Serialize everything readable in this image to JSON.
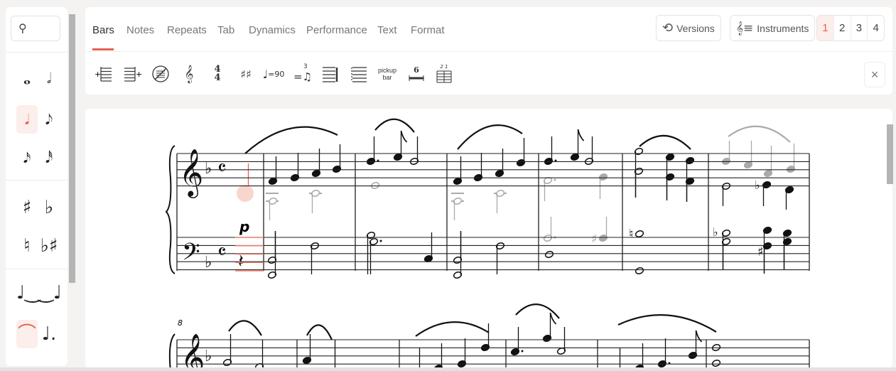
{
  "palette": {
    "search_placeholder": "",
    "search_icon": "magnifier-icon",
    "items": [
      {
        "name": "whole-note-icon",
        "glyph": "𝅝"
      },
      {
        "name": "half-note-icon",
        "glyph": "𝅗𝅥"
      },
      {
        "name": "quarter-note-icon",
        "glyph": "𝅘𝅥",
        "selected": true
      },
      {
        "name": "eighth-note-icon",
        "glyph": "𝅘𝅥𝅮"
      },
      {
        "name": "sixteenth-note-icon",
        "glyph": "𝅘𝅥𝅯"
      },
      {
        "name": "thirty-second-note-icon",
        "glyph": "𝅘𝅥𝅰"
      },
      {
        "name": "sharp-icon",
        "glyph": "♯"
      },
      {
        "name": "flat-icon",
        "glyph": "♭"
      },
      {
        "name": "natural-icon",
        "glyph": "♮"
      },
      {
        "name": "flat-sharp-icon",
        "glyph": "♭♯"
      },
      {
        "name": "tie-after-icon",
        "glyph": "♩‿"
      },
      {
        "name": "tie-before-icon",
        "glyph": "‿♩"
      },
      {
        "name": "slur-icon",
        "glyph": "⌒",
        "selected": true
      },
      {
        "name": "dotted-note-icon",
        "glyph": "♩."
      }
    ]
  },
  "tabs": [
    {
      "label": "Bars",
      "active": true
    },
    {
      "label": "Notes"
    },
    {
      "label": "Repeats"
    },
    {
      "label": "Tab"
    },
    {
      "label": "Dynamics"
    },
    {
      "label": "Performance"
    },
    {
      "label": "Text"
    },
    {
      "label": "Format"
    }
  ],
  "header": {
    "versions_label": "Versions",
    "instruments_label": "Instruments",
    "pages": [
      "1",
      "2",
      "3",
      "4"
    ],
    "active_page": "1"
  },
  "toolbar": {
    "time_sig_top": "4",
    "time_sig_bottom": "4",
    "tempo_label": "=90",
    "tuplet_label": "3",
    "pickup_line1": "pickup",
    "pickup_line2": "bar",
    "multirest_label": "6",
    "endings_label": "2 1",
    "close_label": "×"
  },
  "score": {
    "dynamic": "p",
    "measure_number": "8",
    "key": "F major",
    "time": "C"
  },
  "colors": {
    "accent": "#e8604c",
    "selected_bg": "#fbeeeb"
  }
}
